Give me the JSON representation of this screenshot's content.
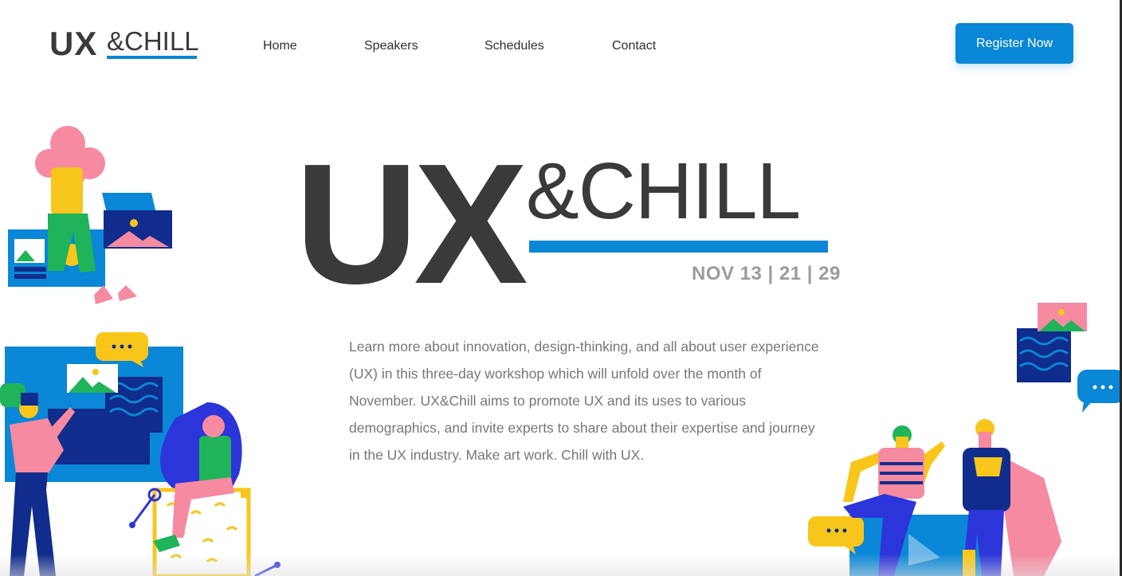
{
  "header": {
    "logo": {
      "ux": "UX",
      "chill": "&CHILL"
    },
    "nav": [
      {
        "label": "Home"
      },
      {
        "label": "Speakers"
      },
      {
        "label": "Schedules"
      },
      {
        "label": "Contact"
      }
    ],
    "register_label": "Register Now"
  },
  "hero": {
    "title_ux": "UX",
    "title_chill": "&CHILL",
    "dates": "NOV 13 | 21 | 29",
    "description": "Learn more about innovation, design-thinking, and all about user experience (UX) in this three-day workshop which will unfold over the month of November. UX&Chill aims to promote UX and its uses to various demographics, and invite experts to share about their expertise and journey in the UX industry. Make art work. Chill with UX."
  },
  "colors": {
    "accent": "#0a87d6",
    "dark_text": "#3a3a3a",
    "muted_text": "#777777",
    "dates": "#9b9b9b",
    "yellow": "#f8c61b",
    "pink": "#f58aa0",
    "navy": "#102c8c",
    "green": "#1fb45a"
  },
  "icons": [
    "chat-bubble-icon",
    "image-icon",
    "person-illustration"
  ]
}
